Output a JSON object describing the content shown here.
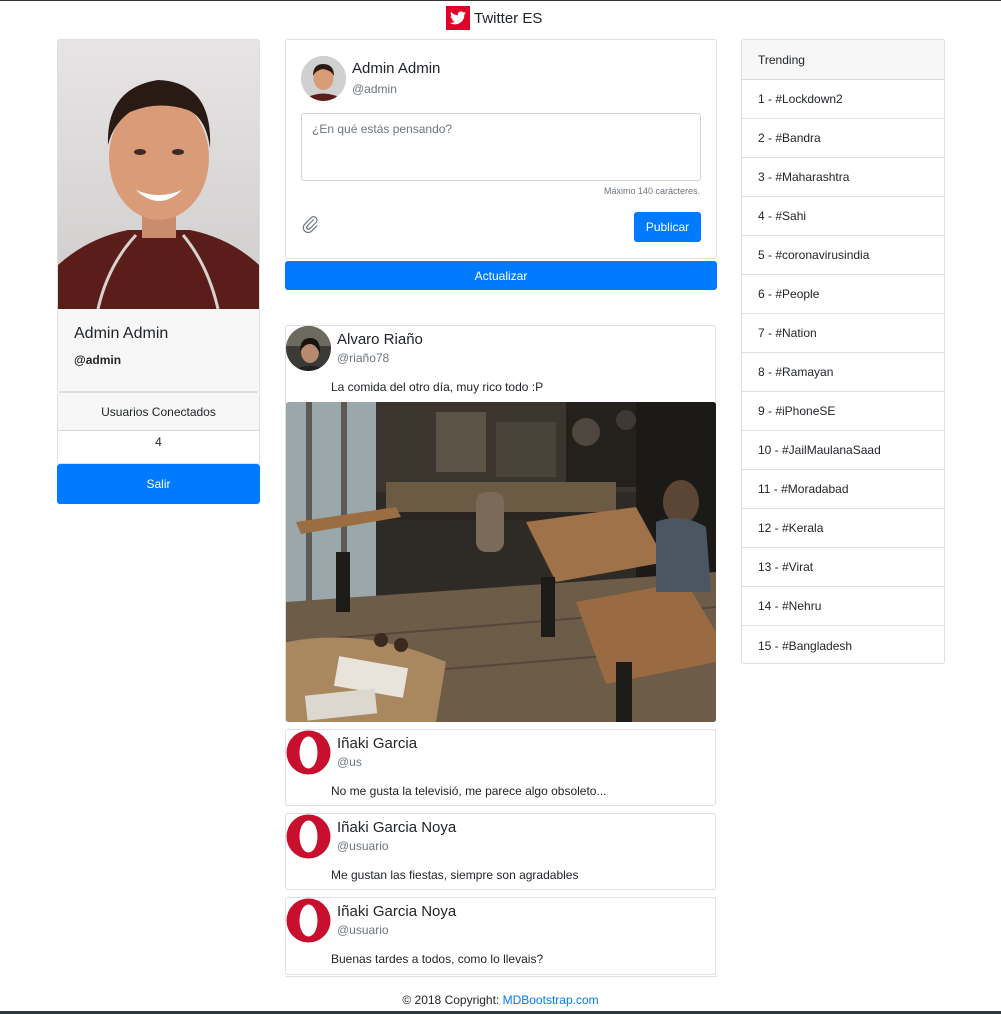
{
  "header": {
    "brand": "Twitter ES",
    "brand_color": "#e0002a"
  },
  "profile": {
    "name": "Admin Admin",
    "handle": "@admin"
  },
  "online": {
    "title": "Usuarios Conectados",
    "count": "4"
  },
  "logout_label": "Salir",
  "compose": {
    "name": "Admin Admin",
    "handle": "@admin",
    "placeholder": "¿En qué estás pensando?",
    "hint": "Máximo 140 carácteres.",
    "publish_label": "Publicar"
  },
  "refresh_label": "Actualizar",
  "tweets": [
    {
      "name": "Alvaro Riaño",
      "handle": "@riaño78",
      "text": "La comida del otro día, muy rico todo :P"
    },
    {
      "name": "Iñaki Garcia",
      "handle": "@us",
      "text": "No me gusta la televisió, me parece algo obsoleto..."
    },
    {
      "name": "Iñaki Garcia Noya",
      "handle": "@usuario",
      "text": "Me gustan las fiestas, siempre son agradables"
    },
    {
      "name": "Iñaki Garcia Noya",
      "handle": "@usuario",
      "text": "Buenas tardes a todos, como lo llevais?"
    }
  ],
  "trending": {
    "title": "Trending",
    "items": [
      "1 - #Lockdown2",
      "2 - #Bandra",
      "3 - #Maharashtra",
      "4 - #Sahi",
      "5 - #coronavirusindia",
      "6 - #People",
      "7 - #Nation",
      "8 - #Ramayan",
      "9 - #iPhoneSE",
      "10 - #JailMaulanaSaad",
      "11 - #Moradabad",
      "12 - #Kerala",
      "13 - #Virat",
      "14 - #Nehru",
      "15 - #Bangladesh"
    ]
  },
  "footer": {
    "text": "© 2018 Copyright: ",
    "link": "MDBootstrap.com"
  },
  "colors": {
    "primary": "#007bff",
    "muted": "#6c757d",
    "opera_red": "#c8102e"
  }
}
